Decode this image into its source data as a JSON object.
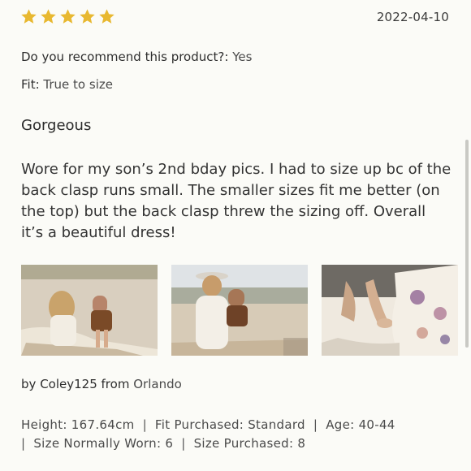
{
  "review": {
    "rating": 5,
    "star_color": "#e8b830",
    "date": "2022-04-10",
    "recommend_label": "Do you recommend this product?:",
    "recommend_value": "Yes",
    "fit_label": "Fit:",
    "fit_value": "True to size",
    "title": "Gorgeous",
    "body": "Wore for my son’s 2nd bday pics. I had to size up bc of the back clasp runs small. The smaller sizes fit me better (on the top) but the back clasp threw the sizing off. Overall it’s a beautiful dress!",
    "photos": [
      "review-photo-1",
      "review-photo-2",
      "review-photo-3"
    ],
    "author_prefix": "by",
    "author_name": "Coley125",
    "author_from": "from",
    "author_location": "Orlando",
    "attributes": {
      "height": "Height: 167.64cm",
      "fit_purchased": "Fit Purchased: Standard",
      "age": "Age: 40-44",
      "size_normally_worn": "Size Normally Worn: 6",
      "size_purchased": "Size Purchased: 8"
    },
    "separator": "|"
  }
}
